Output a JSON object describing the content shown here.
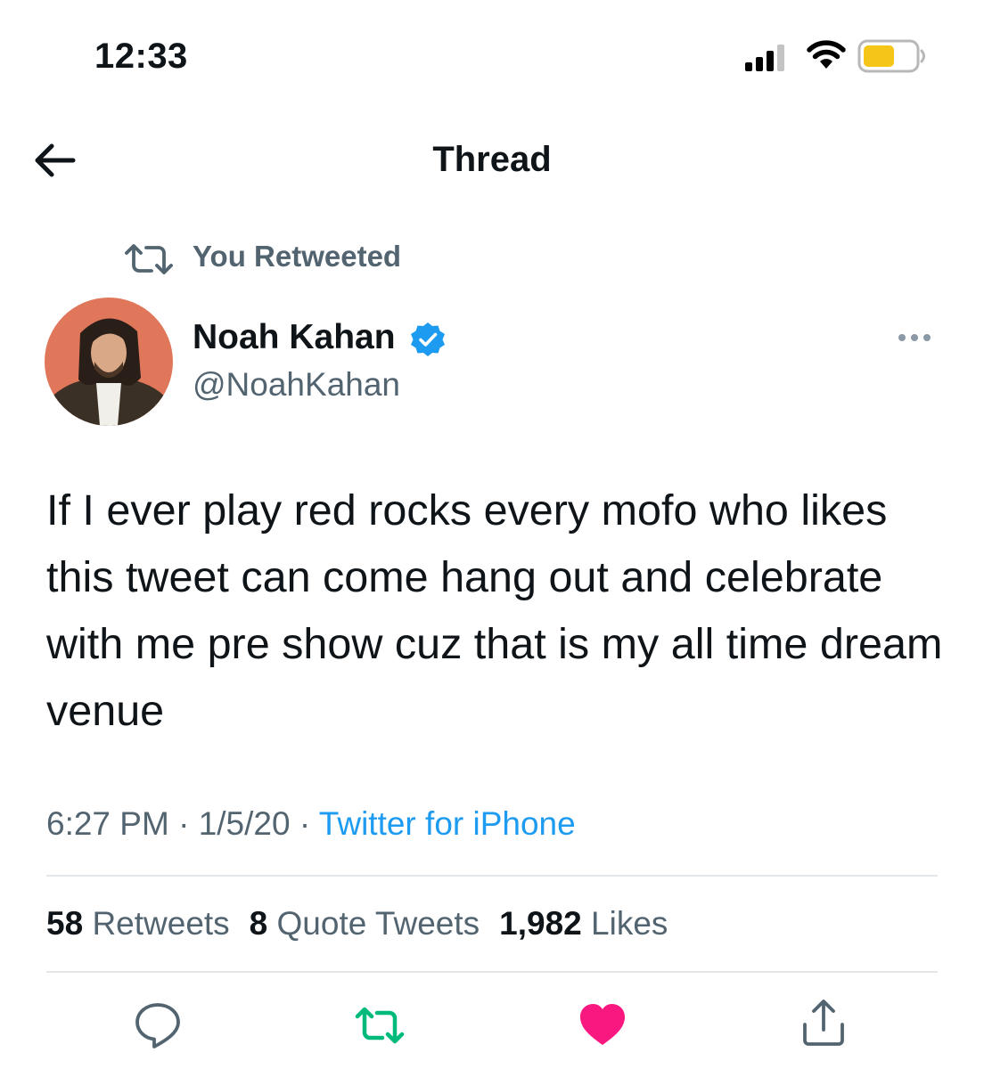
{
  "status_bar": {
    "time": "12:33"
  },
  "header": {
    "title": "Thread"
  },
  "retweet_context": {
    "label": "You Retweeted"
  },
  "tweet": {
    "author_name": "Noah Kahan",
    "author_handle": "@NoahKahan",
    "text": "If I ever play red rocks every mofo who likes this tweet can come hang out and celebrate with me pre show cuz that is my all time dream venue",
    "time": "6:27 PM",
    "separator": "·",
    "date": "1/5/20",
    "source": "Twitter for iPhone"
  },
  "stats": {
    "retweets_count": "58",
    "retweets_label": "Retweets",
    "quotes_count": "8",
    "quotes_label": "Quote Tweets",
    "likes_count": "1,982",
    "likes_label": "Likes"
  },
  "actions": [
    {
      "name": "reply",
      "icon": "reply-icon"
    },
    {
      "name": "retweet",
      "icon": "retweet-icon",
      "active": true
    },
    {
      "name": "like",
      "icon": "heart-icon",
      "active": true
    },
    {
      "name": "share",
      "icon": "share-icon"
    }
  ],
  "colors": {
    "text_primary": "#0f1419",
    "text_secondary": "#536471",
    "link": "#1d9bf0",
    "verified": "#1d9bf0",
    "retweet_active": "#00ba7c",
    "like_active": "#f91880",
    "battery_fill": "#f5c518"
  }
}
